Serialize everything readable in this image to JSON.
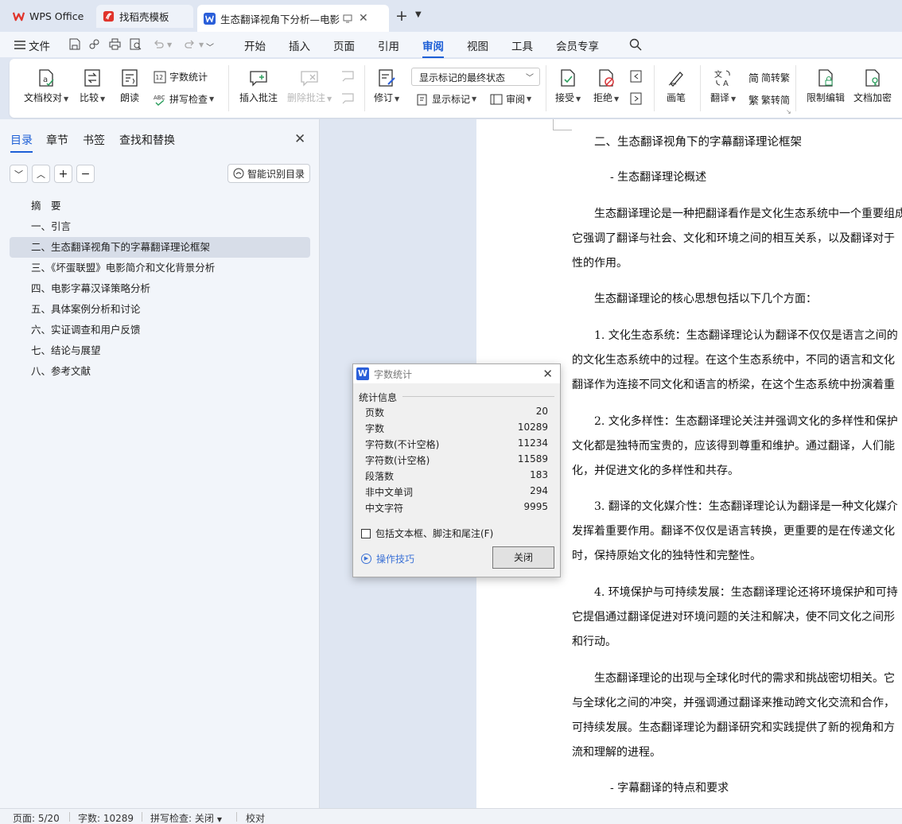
{
  "tabs": {
    "wps": "WPS Office",
    "daoke": "找稻壳模板",
    "doc": "生态翻译视角下分析—电影《",
    "colors": {
      "wps_brand": "#e0342b",
      "doc_brand": "#2b5fd9"
    }
  },
  "menu": {
    "file": "文件",
    "items": [
      "开始",
      "插入",
      "页面",
      "引用",
      "审阅",
      "视图",
      "工具",
      "会员专享"
    ],
    "active": "审阅"
  },
  "ribbon": {
    "doc_check": "文档校对",
    "compare": "比较",
    "read_aloud": "朗读",
    "word_count": "字数统计",
    "spell_check": "拼写检查",
    "insert_comment": "插入批注",
    "delete_comment": "删除批注",
    "track": "修订",
    "markup_mode": "显示标记的最终状态",
    "show_markup": "显示标记",
    "review": "审阅",
    "accept": "接受",
    "reject": "拒绝",
    "pen": "画笔",
    "translate": "翻译",
    "to_traditional": "简转繁",
    "to_simplified": "繁转简",
    "restrict_edit": "限制编辑",
    "encrypt": "文档加密"
  },
  "side": {
    "tabs": [
      "目录",
      "章节",
      "书签",
      "查找和替换"
    ],
    "smart_toc": "智能识别目录",
    "toc": [
      "摘　要",
      "一、引言",
      "二、生态翻译视角下的字幕翻译理论框架",
      "三、《坏蛋联盟》电影简介和文化背景分析",
      "四、电影字幕汉译策略分析",
      "五、具体案例分析和讨论",
      "六、实证调查和用户反馈",
      "七、结论与展望",
      "八、参考文献"
    ],
    "selected_index": 2
  },
  "doc": {
    "h2": "二、生态翻译视角下的字幕翻译理论框架",
    "sub1": "-  生态翻译理论概述",
    "p1": [
      "生态翻译理论是一种把翻译看作是文化生态系统中一个重要组成部分",
      "它强调了翻译与社会、文化和环境之间的相互关系，以及翻译对于",
      "性的作用。"
    ],
    "p2": "生态翻译理论的核心思想包括以下几个方面：",
    "p3": [
      "1. 文化生态系统：生态翻译理论认为翻译不仅仅是语言之间的",
      "的文化生态系统中的过程。在这个生态系统中，不同的语言和文化",
      "翻译作为连接不同文化和语言的桥梁，在这个生态系统中扮演着重"
    ],
    "p4": [
      "2. 文化多样性：生态翻译理论关注并强调文化的多样性和保护",
      "文化都是独特而宝贵的，应该得到尊重和维护。通过翻译，人们能",
      "化，并促进文化的多样性和共存。"
    ],
    "p5": [
      "3. 翻译的文化媒介性：生态翻译理论认为翻译是一种文化媒介",
      "发挥着重要作用。翻译不仅仅是语言转换，更重要的是在传递文化",
      "时，保持原始文化的独特性和完整性。"
    ],
    "p6": [
      "4. 环境保护与可持续发展：生态翻译理论还将环境保护和可持",
      "它提倡通过翻译促进对环境问题的关注和解决，使不同文化之间形",
      "和行动。"
    ],
    "p7": [
      "生态翻译理论的出现与全球化时代的需求和挑战密切相关。它",
      "与全球化之间的冲突，并强调通过翻译来推动跨文化交流和合作，",
      "可持续发展。生态翻译理论为翻译研究和实践提供了新的视角和方",
      "流和理解的进程。"
    ],
    "sub2": "-  字幕翻译的特点和要求"
  },
  "dialog": {
    "title": "字数统计",
    "group": "统计信息",
    "stats": [
      {
        "label": "页数",
        "value": "20"
      },
      {
        "label": "字数",
        "value": "10289"
      },
      {
        "label": "字符数(不计空格)",
        "value": "11234"
      },
      {
        "label": "字符数(计空格)",
        "value": "11589"
      },
      {
        "label": "段落数",
        "value": "183"
      },
      {
        "label": "非中文单词",
        "value": "294"
      },
      {
        "label": "中文字符",
        "value": "9995"
      }
    ],
    "checkbox": "包括文本框、脚注和尾注(F)",
    "checked": false,
    "tips": "操作技巧",
    "close": "关闭"
  },
  "status": {
    "page": "页面: 5/20",
    "words": "字数: 10289",
    "spell": "拼写检查: 关闭",
    "proof": "校对"
  }
}
